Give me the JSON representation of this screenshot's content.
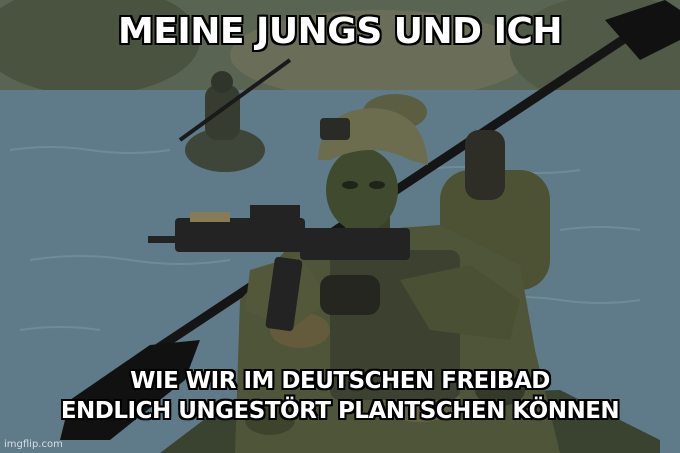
{
  "meme": {
    "top_text": "MEINE JUNGS UND ICH",
    "bottom_text_line1": "WIE WIR IM DEUTSCHEN FREIBAD",
    "bottom_text_line2": "ENDLICH UNGESTÖRT PLANTSCHEN KÖNNEN",
    "watermark": "imgflip.com"
  },
  "photo": {
    "subject": "soldiers-paddling-kayak-on-river",
    "colors": {
      "water": "#5f7a88",
      "camouflage": "#4e5538",
      "face_paint": "#3f4a2e",
      "helmet": "#6b6d4e",
      "rifle": "#232323",
      "paddle": "#111111"
    }
  }
}
